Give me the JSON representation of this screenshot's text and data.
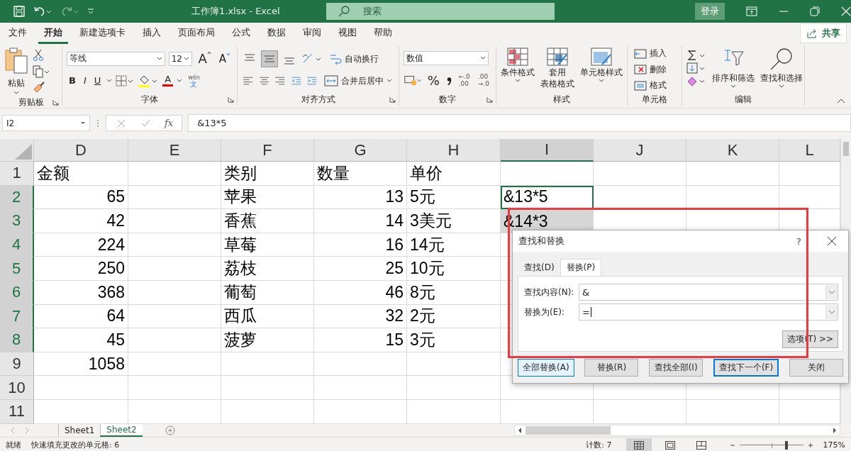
{
  "title_bar": {
    "title": "工作簿1.xlsx  -  Excel",
    "search_placeholder": "搜索",
    "sign_in": "登录"
  },
  "menu_tabs": [
    {
      "label": "文件",
      "selected": false
    },
    {
      "label": "开始",
      "selected": true
    },
    {
      "label": "新建选项卡",
      "selected": false
    },
    {
      "label": "插入",
      "selected": false
    },
    {
      "label": "页面布局",
      "selected": false
    },
    {
      "label": "公式",
      "selected": false
    },
    {
      "label": "数据",
      "selected": false
    },
    {
      "label": "审阅",
      "selected": false
    },
    {
      "label": "视图",
      "selected": false
    },
    {
      "label": "帮助",
      "selected": false
    }
  ],
  "share": "共享",
  "clipboard": {
    "paste": "粘贴",
    "label": "剪贴板"
  },
  "font": {
    "name": "等线",
    "size": "12",
    "grow": "A",
    "shrink": "A",
    "bold": "B",
    "italic": "I",
    "underline": "U",
    "font_color": "A",
    "phonetic_top": "wén",
    "phonetic_bottom": "文",
    "label": "字体"
  },
  "alignment": {
    "wrap": "自动换行",
    "merge": "合并后居中",
    "label": "对齐方式"
  },
  "number": {
    "format": "数值",
    "percent": "%",
    "decimals": [
      {
        "top": "←.0",
        "bottom": ".00"
      },
      {
        "top": ".00",
        "bottom": "→.0"
      }
    ],
    "label": "数字"
  },
  "styles": {
    "conditional": "条件格式",
    "table_format": [
      "套用",
      "表格格式"
    ],
    "cell_styles": "单元格样式",
    "label": "样式"
  },
  "cells": {
    "insert": "插入",
    "delete": "删除",
    "format": "格式",
    "label": "单元格"
  },
  "editing": {
    "sort": "排序和筛选",
    "find": "查找和选择",
    "label": "编辑"
  },
  "formula_bar": {
    "name_box": "I2",
    "fx": "fx",
    "content": "&13*5"
  },
  "columns": [
    {
      "label": "D",
      "selected": false
    },
    {
      "label": "E",
      "selected": false
    },
    {
      "label": "F",
      "selected": false
    },
    {
      "label": "G",
      "selected": false
    },
    {
      "label": "H",
      "selected": false
    },
    {
      "label": "I",
      "selected": true
    },
    {
      "label": "J",
      "selected": false
    },
    {
      "label": "K",
      "selected": false
    },
    {
      "label": "L",
      "selected": false
    }
  ],
  "rows": [
    {
      "number": "1",
      "selected": false,
      "cells": {
        "D": {
          "text": "金额",
          "kind": "text"
        },
        "F": {
          "text": "类别",
          "kind": "text"
        },
        "G": {
          "text": "数量",
          "kind": "text"
        },
        "H": {
          "text": "单价",
          "kind": "text"
        }
      }
    },
    {
      "number": "2",
      "selected": true,
      "cells": {
        "D": {
          "text": "65",
          "kind": "number"
        },
        "F": {
          "text": "苹果",
          "kind": "text"
        },
        "G": {
          "text": "13",
          "kind": "number"
        },
        "H": {
          "text": "5元",
          "kind": "text"
        },
        "I": {
          "text": "&13*5",
          "kind": "text",
          "active": true
        }
      }
    },
    {
      "number": "3",
      "selected": true,
      "cells": {
        "D": {
          "text": "42",
          "kind": "number"
        },
        "F": {
          "text": "香蕉",
          "kind": "text"
        },
        "G": {
          "text": "14",
          "kind": "number"
        },
        "H": {
          "text": "3美元",
          "kind": "text"
        },
        "I": {
          "text": "&14*3",
          "kind": "text",
          "selected": true
        }
      }
    },
    {
      "number": "4",
      "selected": true,
      "cells": {
        "D": {
          "text": "224",
          "kind": "number"
        },
        "F": {
          "text": "草莓",
          "kind": "text"
        },
        "G": {
          "text": "16",
          "kind": "number"
        },
        "H": {
          "text": "14元",
          "kind": "text"
        }
      }
    },
    {
      "number": "5",
      "selected": true,
      "cells": {
        "D": {
          "text": "250",
          "kind": "number"
        },
        "F": {
          "text": "荔枝",
          "kind": "text"
        },
        "G": {
          "text": "25",
          "kind": "number"
        },
        "H": {
          "text": "10元",
          "kind": "text"
        }
      }
    },
    {
      "number": "6",
      "selected": true,
      "cells": {
        "D": {
          "text": "368",
          "kind": "number"
        },
        "F": {
          "text": "葡萄",
          "kind": "text"
        },
        "G": {
          "text": "46",
          "kind": "number"
        },
        "H": {
          "text": "8元",
          "kind": "text"
        }
      }
    },
    {
      "number": "7",
      "selected": true,
      "cells": {
        "D": {
          "text": "64",
          "kind": "number"
        },
        "F": {
          "text": "西瓜",
          "kind": "text"
        },
        "G": {
          "text": "32",
          "kind": "number"
        },
        "H": {
          "text": "2元",
          "kind": "text"
        }
      }
    },
    {
      "number": "8",
      "selected": true,
      "cells": {
        "D": {
          "text": "45",
          "kind": "number"
        },
        "F": {
          "text": "菠萝",
          "kind": "text"
        },
        "G": {
          "text": "15",
          "kind": "number"
        },
        "H": {
          "text": "3元",
          "kind": "text"
        }
      }
    },
    {
      "number": "9",
      "selected": false,
      "cells": {
        "D": {
          "text": "1058",
          "kind": "number"
        }
      }
    },
    {
      "number": "10",
      "selected": false
    },
    {
      "number": "11",
      "selected": false
    }
  ],
  "dialog": {
    "title": "查找和替换",
    "help": "?",
    "tabs": [
      {
        "label": "查找(D)",
        "selected": false
      },
      {
        "label": "替换(P)",
        "selected": true
      }
    ],
    "fields": [
      {
        "label": "查找内容(N):",
        "value": "&",
        "focused": false
      },
      {
        "label": "替换为(E):",
        "value": "=",
        "focused": true
      }
    ],
    "options": "选项(T) >>",
    "buttons": [
      {
        "label": "全部替换(A)",
        "kind": "default"
      },
      {
        "label": "替换(R)",
        "kind": "normal"
      },
      {
        "label": "查找全部(I)",
        "kind": "normal"
      },
      {
        "label": "查找下一个(F)",
        "kind": "focused"
      },
      {
        "label": "关闭",
        "kind": "normal"
      }
    ]
  },
  "sheet_tabs": [
    {
      "label": "Sheet1",
      "selected": false
    },
    {
      "label": "Sheet2",
      "selected": true
    }
  ],
  "status_bar": {
    "ready": "就绪",
    "message": "快速填充更改的单元格: 6",
    "count": "计数: 7",
    "views": [
      {
        "kind": "normal",
        "selected": true
      },
      {
        "kind": "page_layout",
        "selected": false
      },
      {
        "kind": "page_break",
        "selected": false
      }
    ],
    "zoom": {
      "level": 0.72
    },
    "zoom_label": "175%"
  }
}
